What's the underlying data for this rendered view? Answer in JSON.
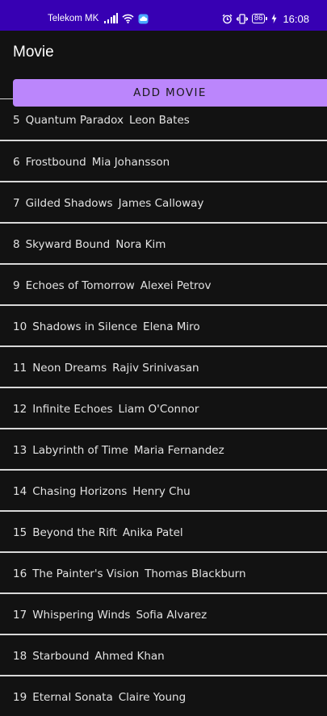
{
  "status_bar": {
    "carrier": "Telekom MK",
    "battery": "86",
    "time": "16:08"
  },
  "app_bar": {
    "title": "Movie"
  },
  "toolbar": {
    "add_label": "ADD MOVIE"
  },
  "colors": {
    "status_bar": "#3700b3",
    "accent": "#bb86fc",
    "background": "#121212",
    "divider": "#d8d8d8"
  },
  "movies": [
    {
      "id": "5",
      "title": "Quantum Paradox",
      "director": "Leon Bates"
    },
    {
      "id": "6",
      "title": "Frostbound",
      "director": "Mia Johansson"
    },
    {
      "id": "7",
      "title": "Gilded Shadows",
      "director": "James Calloway"
    },
    {
      "id": "8",
      "title": "Skyward Bound",
      "director": "Nora Kim"
    },
    {
      "id": "9",
      "title": "Echoes of Tomorrow",
      "director": "Alexei Petrov"
    },
    {
      "id": "10",
      "title": "Shadows in Silence",
      "director": "Elena Miro"
    },
    {
      "id": "11",
      "title": "Neon Dreams",
      "director": "Rajiv Srinivasan"
    },
    {
      "id": "12",
      "title": "Infinite Echoes",
      "director": "Liam O'Connor"
    },
    {
      "id": "13",
      "title": "Labyrinth of Time",
      "director": "Maria Fernandez"
    },
    {
      "id": "14",
      "title": "Chasing Horizons",
      "director": "Henry Chu"
    },
    {
      "id": "15",
      "title": "Beyond the Rift",
      "director": "Anika Patel"
    },
    {
      "id": "16",
      "title": "The Painter's Vision",
      "director": "Thomas Blackburn"
    },
    {
      "id": "17",
      "title": "Whispering Winds",
      "director": "Sofia Alvarez"
    },
    {
      "id": "18",
      "title": "Starbound",
      "director": "Ahmed Khan"
    },
    {
      "id": "19",
      "title": "Eternal Sonata",
      "director": "Claire Young"
    }
  ]
}
